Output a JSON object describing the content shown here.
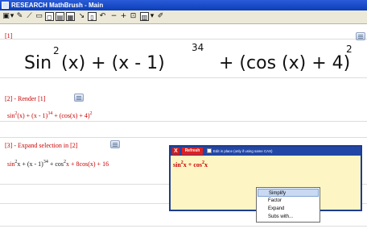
{
  "window": {
    "title": "RESEARCH MathBrush - Main"
  },
  "toolbar": {
    "icons": [
      {
        "name": "select-icon",
        "glyph": "▣"
      },
      {
        "name": "dropdown-icon",
        "glyph": "▾"
      },
      {
        "name": "pen-icon",
        "glyph": "✎"
      },
      {
        "name": "lasso-icon",
        "glyph": "⟋"
      },
      {
        "name": "eraser-icon",
        "glyph": "▭"
      },
      {
        "name": "clear-icon",
        "glyph": "◻"
      },
      {
        "name": "save-icon",
        "glyph": "▤"
      },
      {
        "name": "open-icon",
        "glyph": "▦"
      },
      {
        "name": "pen2-icon",
        "glyph": "↘"
      },
      {
        "name": "doc-icon",
        "glyph": "▯"
      },
      {
        "name": "undo-icon",
        "glyph": "↶"
      },
      {
        "name": "minus-icon",
        "glyph": "−"
      },
      {
        "name": "plus-icon",
        "glyph": "+"
      },
      {
        "name": "blank-icon",
        "glyph": "⊡"
      },
      {
        "name": "print-icon",
        "glyph": "▥"
      },
      {
        "name": "menu-dropdown-icon",
        "glyph": "▾"
      },
      {
        "name": "brush-icon",
        "glyph": "✐"
      }
    ]
  },
  "cells": [
    {
      "label": "[1]"
    },
    {
      "label": "[2] - Render  [1]"
    },
    {
      "label": "[3] - Expand selection in [2]"
    }
  ],
  "handwriting": {
    "sin": "Sin",
    "sin_exp": "2",
    "rest1": "(x)  +  (x - 1)",
    "exp34": "34",
    "rest2": "+  (cos  (x)  + 4)",
    "exp2": "2"
  },
  "render_line": {
    "a": "sin",
    "a_exp": "2",
    "b": "(x) + (x - 1)",
    "b_exp": "34",
    "c": " + (cos(x) + 4)",
    "c_exp": "2"
  },
  "expand_line": {
    "a": "sin",
    "a_exp": "2",
    "b": "x + (x - 1)",
    "b_exp": "34",
    "c": " + cos",
    "c_exp": "2",
    "d": "x + 8cos(x) + 16"
  },
  "panel": {
    "close_glyph": "X",
    "refresh_label": "Refresh",
    "checkbox_label": "Edit in place (only if using same CAS)",
    "expr_a": "sin",
    "expr_a_exp": "2",
    "expr_b": "x + cos",
    "expr_b_exp": "2",
    "expr_c": "x"
  },
  "context_menu": {
    "items": [
      "Simplify",
      "Factor",
      "Expand",
      "Subs with..."
    ]
  }
}
